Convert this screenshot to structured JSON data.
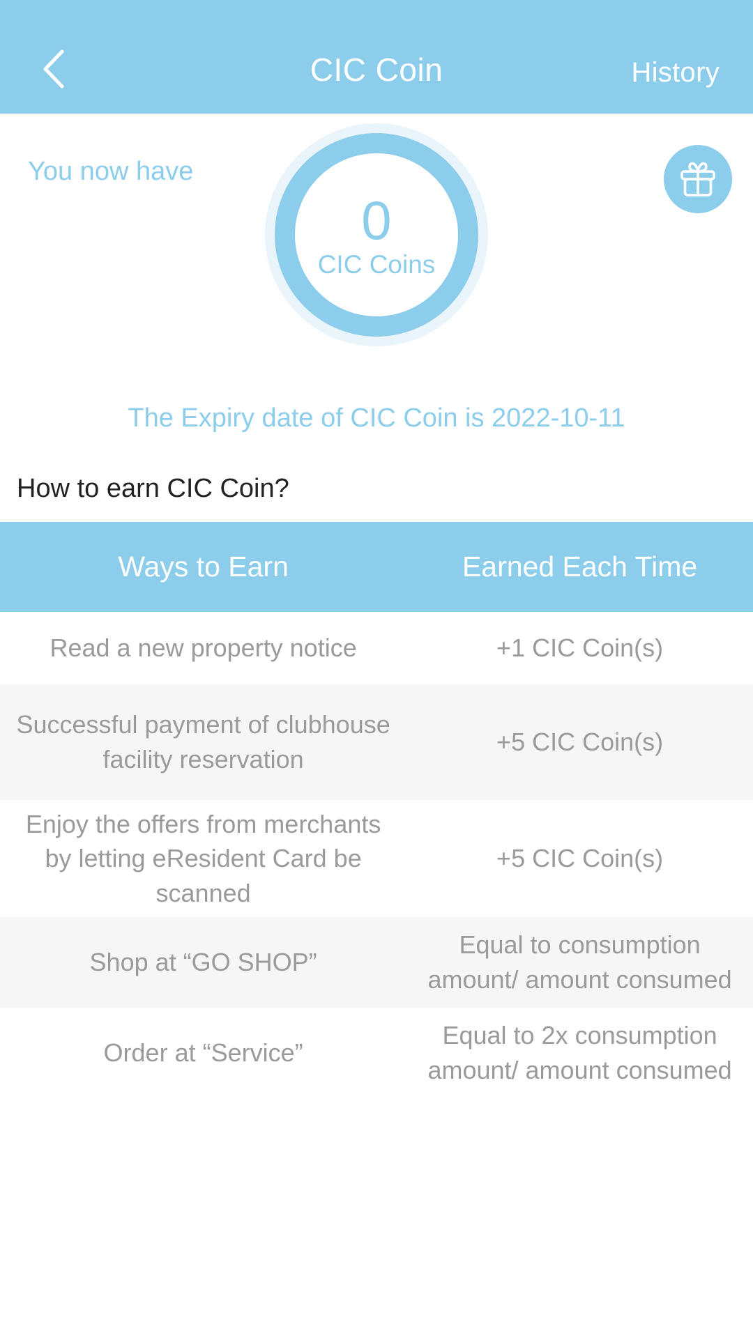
{
  "header": {
    "back_icon": "chevron-left-icon",
    "title": "CIC Coin",
    "action_label": "History"
  },
  "balance": {
    "label": "You now have",
    "amount": "0",
    "unit": "CIC Coins",
    "gift_icon": "gift-icon",
    "expiry_text": "The Expiry date of CIC Coin is 2022-10-11"
  },
  "section": {
    "how_to_earn_title": "How to earn CIC Coin?"
  },
  "table": {
    "columns": [
      "Ways to Earn",
      "Earned Each Time"
    ],
    "rows": [
      {
        "way": "Read a new property notice",
        "earned": "+1 CIC Coin(s)"
      },
      {
        "way": "Successful payment of clubhouse facility reservation",
        "earned": "+5 CIC Coin(s)"
      },
      {
        "way": "Enjoy the offers from merchants by letting eResident Card be scanned",
        "earned": "+5 CIC Coin(s)"
      },
      {
        "way": "Shop at “GO SHOP”",
        "earned": "Equal to consumption amount/ amount consumed"
      },
      {
        "way": "Order at “Service”",
        "earned": "Equal to 2x consumption amount/ amount consumed"
      }
    ]
  },
  "colors": {
    "brand_blue": "#8ccdec",
    "ring_glow": "#e9f5fb",
    "row_alt": "#f6f6f6",
    "row_text": "#9a9a9a",
    "heading_text": "#222222"
  }
}
